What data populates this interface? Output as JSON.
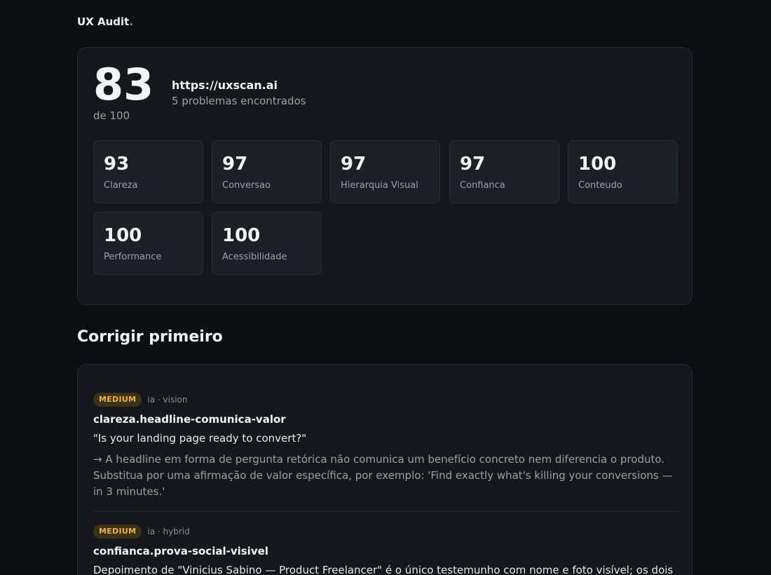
{
  "brand": {
    "name": "UX Audit",
    "dot": "."
  },
  "summary": {
    "score": "83",
    "score_of": "de 100",
    "url": "https://uxscan.ai",
    "problems": "5 problemas encontrados"
  },
  "metrics": [
    {
      "value": "93",
      "label": "Clareza"
    },
    {
      "value": "97",
      "label": "Conversao"
    },
    {
      "value": "97",
      "label": "Hierarquia Visual"
    },
    {
      "value": "97",
      "label": "Confianca"
    },
    {
      "value": "100",
      "label": "Conteudo"
    },
    {
      "value": "100",
      "label": "Performance"
    },
    {
      "value": "100",
      "label": "Acessibilidade"
    }
  ],
  "fix_first": {
    "title": "Corrigir primeiro",
    "issues": [
      {
        "severity": "MEDIUM",
        "source": "ia · vision",
        "id": "clareza.headline-comunica-valor",
        "quote": "\"Is your landing page ready to convert?\"",
        "recommendation": "→ A headline em forma de pergunta retórica não comunica um benefício concreto nem diferencia o produto. Substitua por uma afirmação de valor específica, por exemplo: 'Find exactly what's killing your conversions — in 3 minutes.'"
      },
      {
        "severity": "MEDIUM",
        "source": "ia · hybrid",
        "id": "confianca.prova-social-visivel",
        "quote": "Depoimento de \"Vinicius Sabino — Product Freelancer\" é o único testemunho com nome e foto visível; os dois"
      }
    ]
  },
  "colors": {
    "background": "#0d0e12",
    "card": "#15171d",
    "tile": "#1c1f26",
    "badge_medium_bg": "#3a3218",
    "badge_medium_text": "#f0b429"
  }
}
